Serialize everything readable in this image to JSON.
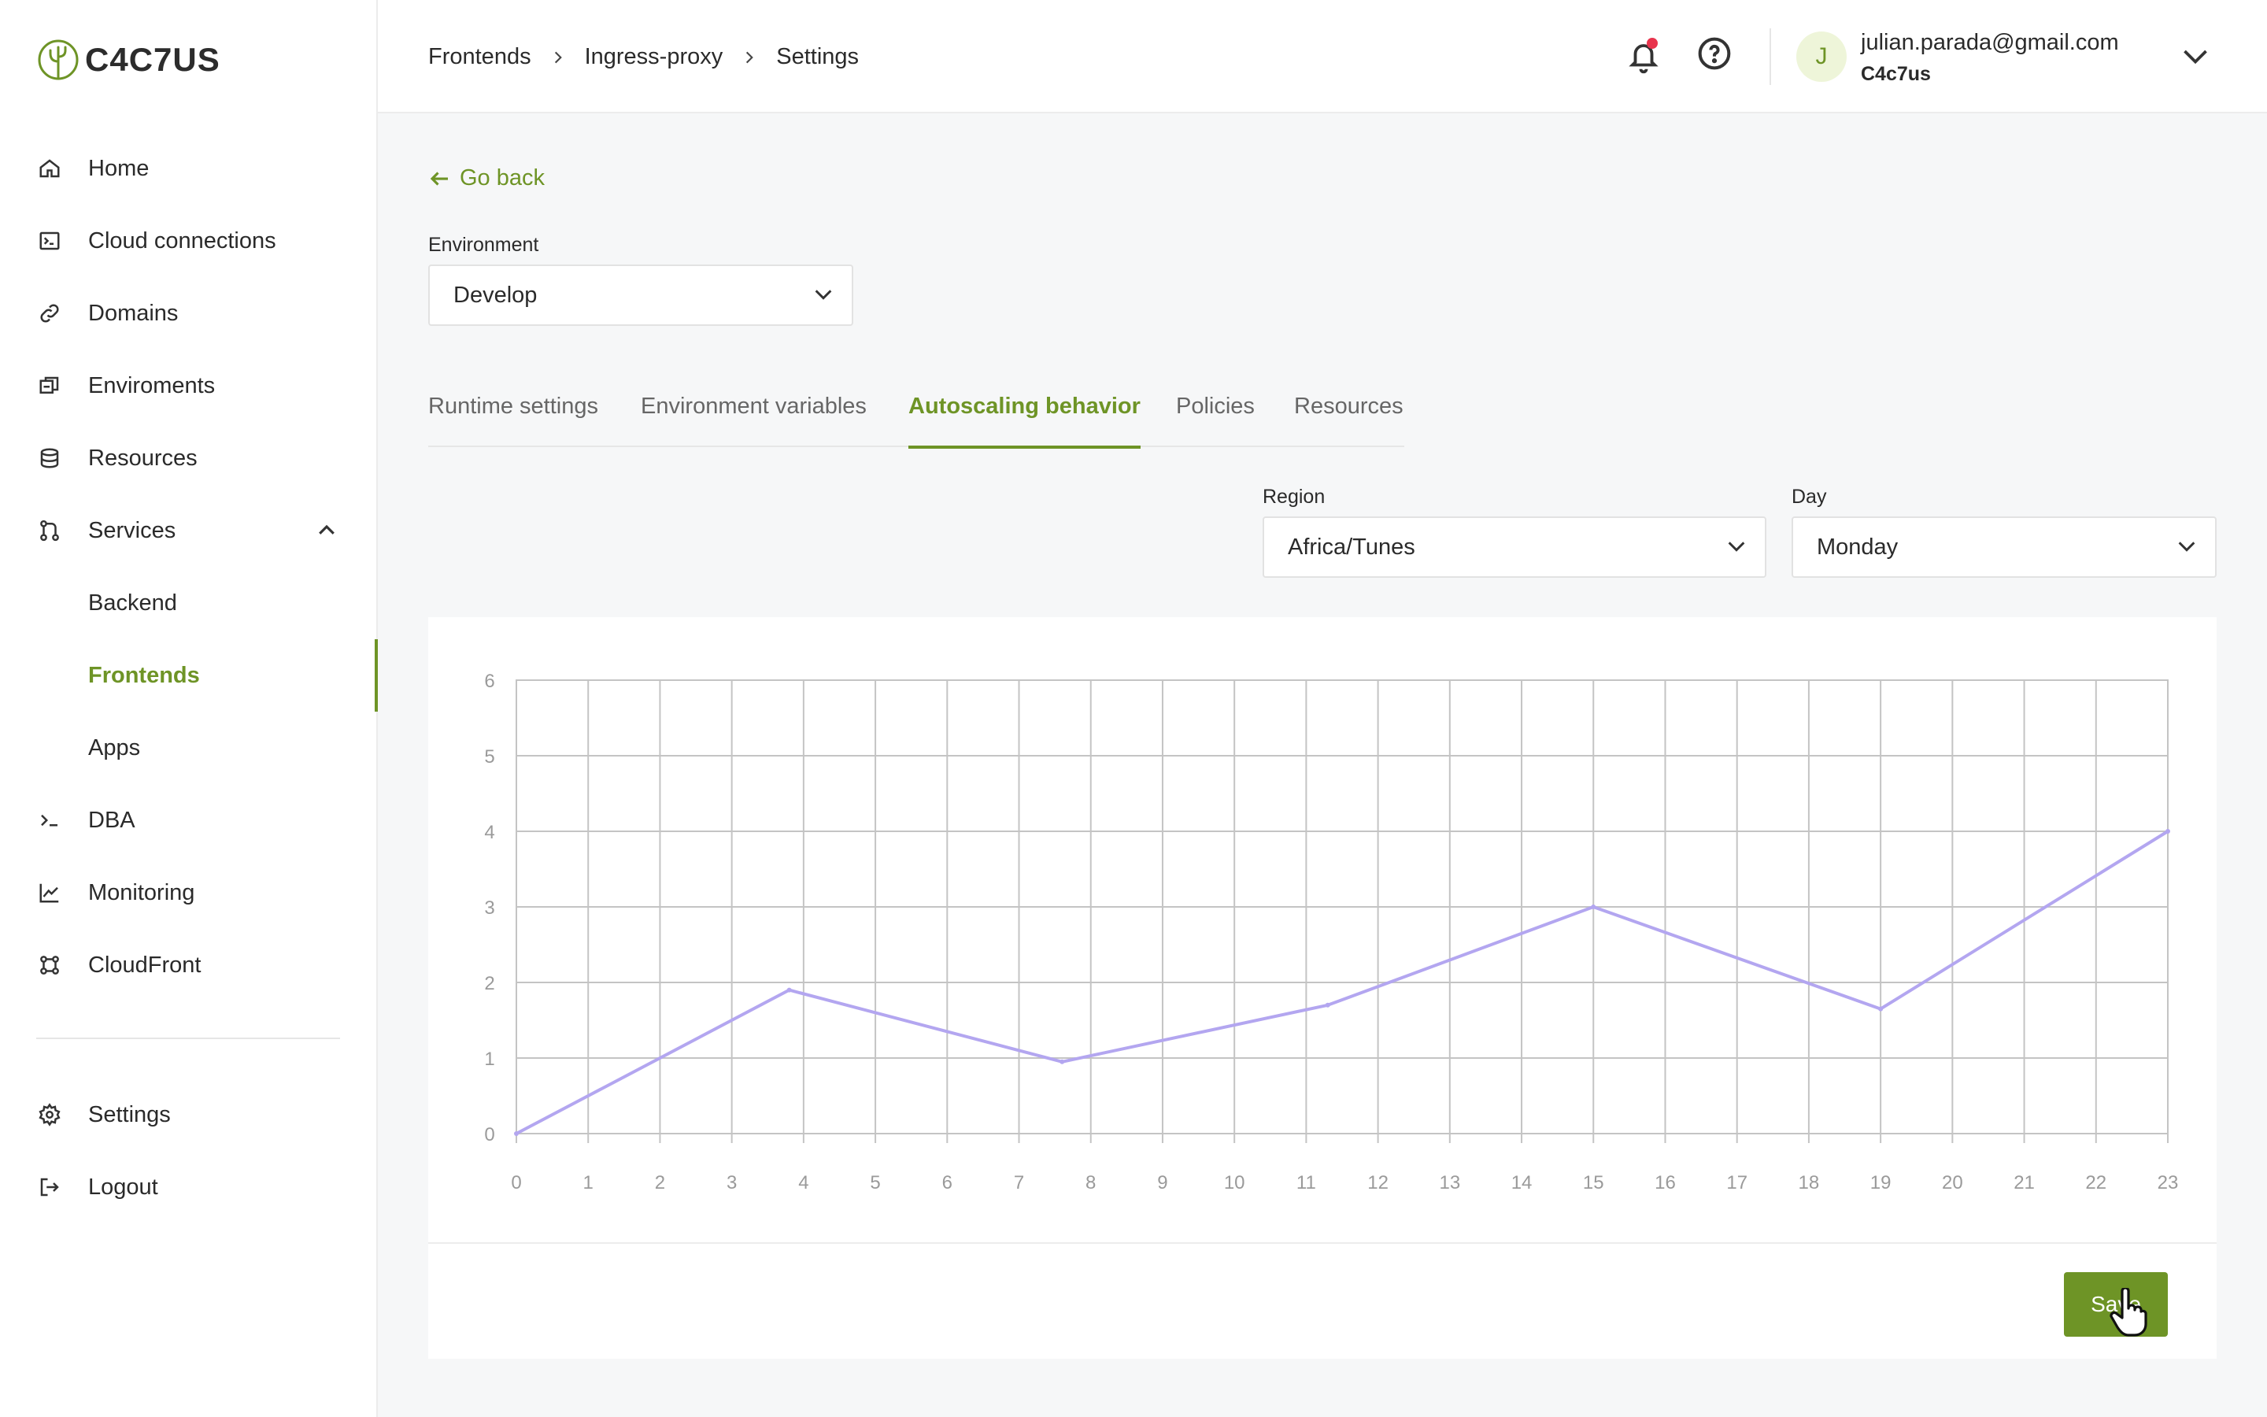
{
  "brand": {
    "name": "C4C7US"
  },
  "sidebar": {
    "items": [
      {
        "label": "Home",
        "icon": "home-icon"
      },
      {
        "label": "Cloud connections",
        "icon": "terminal-box-icon"
      },
      {
        "label": "Domains",
        "icon": "link-icon"
      },
      {
        "label": "Enviroments",
        "icon": "environments-icon"
      },
      {
        "label": "Resources",
        "icon": "database-icon"
      },
      {
        "label": "Services",
        "icon": "services-icon",
        "expanded": true
      },
      {
        "label": "DBA",
        "icon": "prompt-icon"
      },
      {
        "label": "Monitoring",
        "icon": "chart-line-icon"
      },
      {
        "label": "CloudFront",
        "icon": "cloudfront-icon"
      }
    ],
    "services_sub": [
      {
        "label": "Backend"
      },
      {
        "label": "Frontends",
        "active": true
      },
      {
        "label": "Apps"
      }
    ],
    "bottom": [
      {
        "label": "Settings",
        "icon": "gear-icon"
      },
      {
        "label": "Logout",
        "icon": "logout-icon"
      }
    ]
  },
  "header": {
    "breadcrumb": [
      "Frontends",
      "Ingress-proxy",
      "Settings"
    ],
    "notifications": {
      "has_unread": true
    },
    "user": {
      "initial": "J",
      "email": "julian.parada@gmail.com",
      "org": "C4c7us"
    }
  },
  "main": {
    "go_back": "Go back",
    "environment": {
      "label": "Environment",
      "value": "Develop"
    },
    "tabs": [
      {
        "label": "Runtime settings"
      },
      {
        "label": "Environment variables"
      },
      {
        "label": "Autoscaling behavior",
        "active": true
      },
      {
        "label": "Policies"
      },
      {
        "label": "Resources"
      }
    ],
    "region": {
      "label": "Region",
      "value": "Africa/Tunes"
    },
    "day": {
      "label": "Day",
      "value": "Monday"
    },
    "save_label": "Save"
  },
  "colors": {
    "accent": "#6e9426",
    "line": "#b3a6f0",
    "grid": "#c4c4c4",
    "notification": "#e8344d"
  },
  "chart_data": {
    "type": "line",
    "title": "",
    "xlabel": "",
    "ylabel": "",
    "x_ticks": [
      0,
      1,
      2,
      3,
      4,
      5,
      6,
      7,
      8,
      9,
      10,
      11,
      12,
      13,
      14,
      15,
      16,
      17,
      18,
      19,
      20,
      21,
      22,
      23
    ],
    "y_ticks": [
      0,
      1,
      2,
      3,
      4,
      5,
      6
    ],
    "xlim": [
      0,
      23
    ],
    "ylim": [
      0,
      6
    ],
    "grid": true,
    "series": [
      {
        "points": [
          [
            0,
            0
          ],
          [
            3.8,
            1.9
          ],
          [
            7.6,
            0.95
          ],
          [
            11.3,
            1.7
          ],
          [
            15,
            3
          ],
          [
            19,
            1.65
          ],
          [
            23,
            4
          ]
        ]
      }
    ]
  }
}
